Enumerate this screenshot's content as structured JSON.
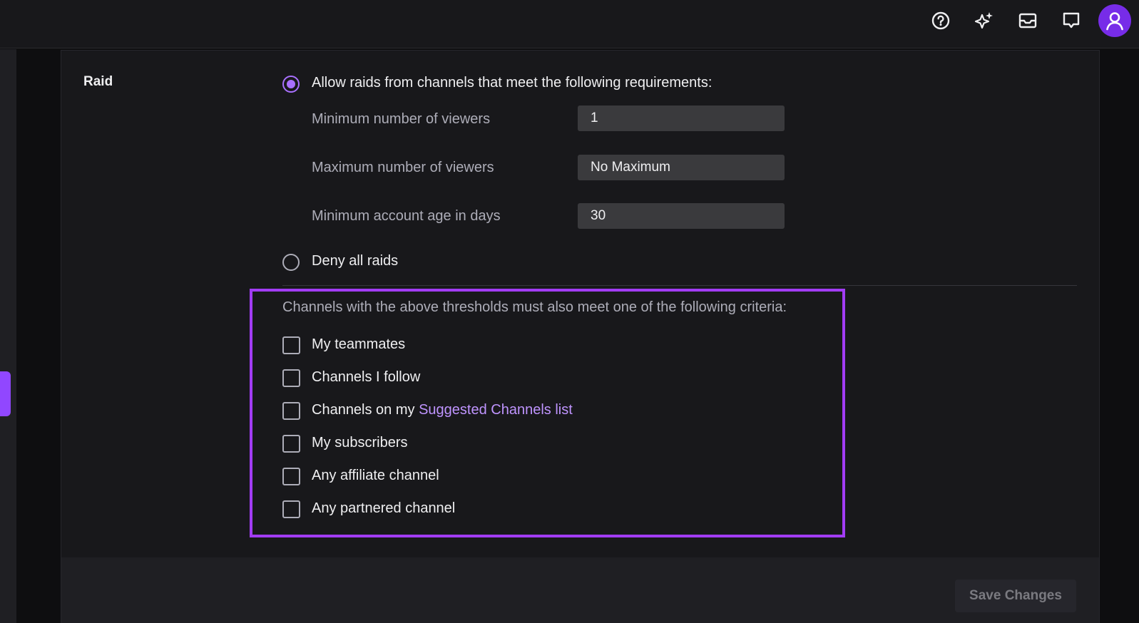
{
  "topbar": {
    "icons": [
      "help-circle-icon",
      "sparkle-icon",
      "inbox-icon",
      "chat-bubble-icon",
      "user-avatar-icon"
    ],
    "accent": "#772ce8"
  },
  "raid": {
    "section_label": "Raid",
    "allow_option": {
      "label": "Allow raids from channels that meet the following requirements:",
      "selected": true
    },
    "fields": [
      {
        "label": "Minimum number of viewers",
        "value": "1"
      },
      {
        "label": "Maximum number of viewers",
        "value": "No Maximum"
      },
      {
        "label": "Minimum account age in days",
        "value": "30"
      }
    ],
    "deny_option": {
      "label": "Deny all raids",
      "selected": false
    },
    "criteria": {
      "intro": "Channels with the above thresholds must also meet one of the following criteria:",
      "items": [
        {
          "label": "My teammates",
          "checked": false
        },
        {
          "label": "Channels I follow",
          "checked": false
        },
        {
          "label_prefix": "Channels on my ",
          "link": "Suggested Channels list",
          "checked": false
        },
        {
          "label": "My subscribers",
          "checked": false
        },
        {
          "label": "Any affiliate channel",
          "checked": false
        },
        {
          "label": "Any partnered channel",
          "checked": false
        }
      ]
    }
  },
  "footer": {
    "save_label": "Save Changes"
  },
  "colors": {
    "accent": "#a970ff",
    "highlight_border": "#a23cf5",
    "link": "#bf94ff",
    "background": "#0e0e10",
    "panel": "#18181b"
  }
}
